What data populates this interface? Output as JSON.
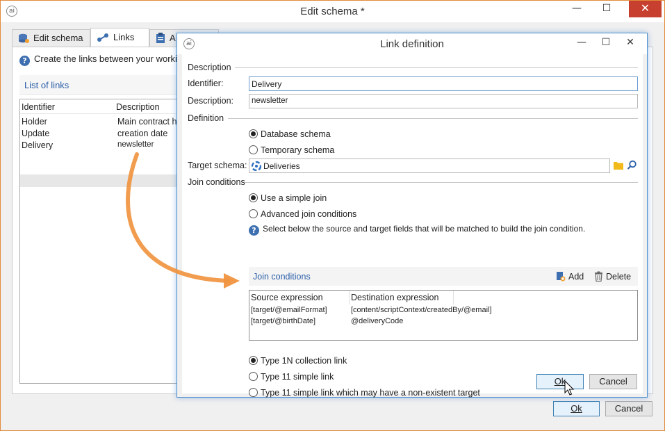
{
  "outer_window": {
    "title": "Edit schema *",
    "minimize": "—",
    "maximize": "☐",
    "close": "✕",
    "tabs": [
      {
        "label": "Edit schema"
      },
      {
        "label": "Links"
      },
      {
        "label": "A"
      }
    ],
    "info_text": "Create the links between your working",
    "links_header": "List of links",
    "list": {
      "columns": [
        "Identifier",
        "Description"
      ],
      "rows": [
        {
          "identifier": "Holder",
          "description": "Main contract ho"
        },
        {
          "identifier": "Update",
          "description": "creation date"
        },
        {
          "identifier": "Delivery",
          "description": "newsletter"
        }
      ]
    },
    "ok_label": "Ok",
    "cancel_label": "Cancel"
  },
  "dialog": {
    "title": "Link definition",
    "minimize": "—",
    "maximize": "☐",
    "close": "✕",
    "section_description": "Description",
    "identifier_label": "Identifier:",
    "identifier_value": "Delivery",
    "description_label": "Description:",
    "description_value": "newsletter",
    "section_definition": "Definition",
    "radio_database_schema": "Database schema",
    "radio_temporary_schema": "Temporary schema",
    "target_schema_label": "Target schema:",
    "target_schema_value": "Deliveries",
    "section_join": "Join conditions",
    "radio_simple_join": "Use a simple join",
    "radio_advanced_join": "Advanced join conditions",
    "join_info": "Select below the source and target fields that will be matched to build the join condition.",
    "jc_title": "Join conditions",
    "add_label": "Add",
    "delete_label": "Delete",
    "jc_columns": [
      "Source expression",
      "Destination expression"
    ],
    "jc_rows": [
      {
        "source": "[target/@emailFormat]",
        "destination": "[content/scriptContext/createdBy/@email]"
      },
      {
        "source": "[target/@birthDate]",
        "destination": "@deliveryCode"
      }
    ],
    "radio_type_1n": "Type 1N collection link",
    "radio_type_11": "Type 11 simple link",
    "radio_type_11_nonexistent": "Type 11 simple link which may have a non-existent target",
    "ok_label": "Ok",
    "cancel_label": "Cancel"
  },
  "colors": {
    "accent_blue": "#2a5ea8",
    "arrow_orange": "#f0943f",
    "close_red": "#c7402f"
  }
}
